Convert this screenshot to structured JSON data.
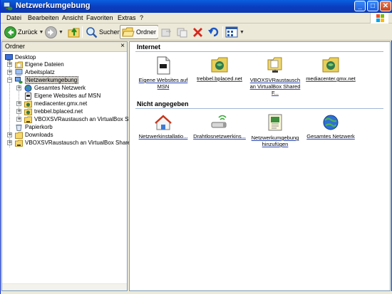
{
  "window": {
    "title": "Netzwerkumgebung",
    "controls": {
      "minimize": "_",
      "maximize": "□",
      "close": "✕"
    }
  },
  "menubar": {
    "items": [
      "Datei",
      "Bearbeiten",
      "Ansicht",
      "Favoriten",
      "Extras",
      "?"
    ]
  },
  "toolbar": {
    "back_label": "Zurück",
    "search_label": "Suchen",
    "folders_label": "Ordner"
  },
  "folder_pane": {
    "title": "Ordner",
    "close": "×",
    "items": [
      {
        "label": "Desktop",
        "level": 0,
        "icon": "desktop-icon",
        "expander": ""
      },
      {
        "label": "Eigene Dateien",
        "level": 1,
        "icon": "my-documents-icon",
        "expander": "+"
      },
      {
        "label": "Arbeitsplatz",
        "level": 1,
        "icon": "my-computer-icon",
        "expander": "+"
      },
      {
        "label": "Netzwerkumgebung",
        "level": 1,
        "icon": "network-places-icon",
        "expander": "−",
        "selected": true
      },
      {
        "label": "Gesamtes Netzwerk",
        "level": 2,
        "icon": "entire-network-icon",
        "expander": "+"
      },
      {
        "label": "Eigene Websites auf MSN",
        "level": 2,
        "icon": "msn-websites-icon",
        "expander": ""
      },
      {
        "label": "mediacenter.gmx.net",
        "level": 2,
        "icon": "web-folder-icon",
        "expander": "+"
      },
      {
        "label": "trebbel.bplaced.net",
        "level": 2,
        "icon": "web-folder-icon",
        "expander": "+"
      },
      {
        "label": "VBOXSVRaustausch an VirtualBox Share",
        "level": 2,
        "icon": "share-folder-icon",
        "expander": "+"
      },
      {
        "label": "Papierkorb",
        "level": 1,
        "icon": "recycle-bin-icon",
        "expander": ""
      },
      {
        "label": "Downloads",
        "level": 1,
        "icon": "folder-icon",
        "expander": "+"
      },
      {
        "label": "VBOXSVRaustausch an VirtualBox Shared Fo",
        "level": 1,
        "icon": "share-folder-icon",
        "expander": "+"
      }
    ]
  },
  "content": {
    "groups": [
      {
        "title": "Internet",
        "items": [
          {
            "label": "Eigene Websites auf MSN",
            "icon": "msn-websites-icon"
          },
          {
            "label": "trebbel.bplaced.net",
            "icon": "web-folder-icon"
          },
          {
            "label": "VBOXSVRaustausch an VirtualBox Shared F...",
            "icon": "share-folder-icon"
          },
          {
            "label": "mediacenter.gmx.net",
            "icon": "web-folder-icon"
          }
        ]
      },
      {
        "title": "Nicht angegeben",
        "items": [
          {
            "label": "Netzwerkinstallatio...",
            "icon": "network-setup-icon"
          },
          {
            "label": "Drahtlosnetzwerkins...",
            "icon": "wireless-setup-icon"
          },
          {
            "label": "Netzwerkumgebung hinzufügen",
            "icon": "add-network-place-icon"
          },
          {
            "label": "Gesamtes Netzwerk",
            "icon": "entire-network-icon"
          }
        ]
      }
    ]
  },
  "colors": {
    "titlebar": "#0a3dbd",
    "window_bg": "#ece9d8",
    "pane_border": "#7f9db9",
    "group_line": "#9eb6d8"
  }
}
